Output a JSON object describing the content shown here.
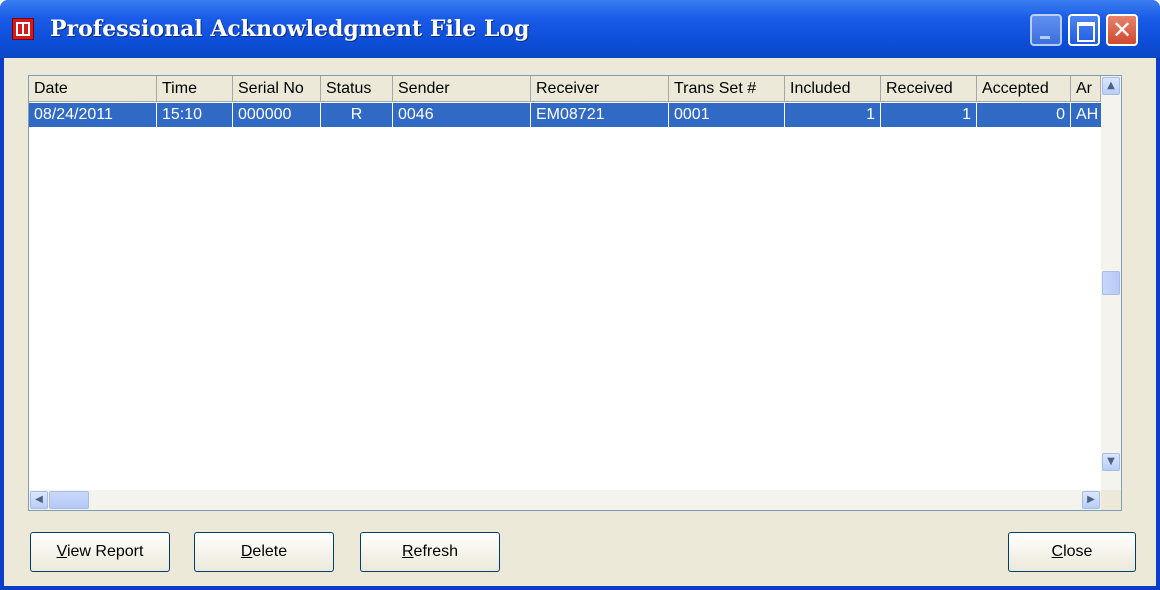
{
  "window": {
    "title": "Professional Acknowledgment File Log"
  },
  "columns": [
    "Date",
    "Time",
    "Serial No",
    "Status",
    "Sender",
    "Receiver",
    "Trans Set #",
    "Included",
    "Received",
    "Accepted",
    "Ar"
  ],
  "rows": [
    {
      "date": "08/24/2011",
      "time": "15:10",
      "serial": "000000",
      "status": "R",
      "sender": "0046",
      "receiver": "EM08721",
      "trans_set": "0001",
      "included": "1",
      "received": "1",
      "accepted": "0",
      "ar": "AH"
    }
  ],
  "selected_row": 0,
  "buttons": {
    "view_report": {
      "mnemonic": "V",
      "rest": "iew Report"
    },
    "delete": {
      "mnemonic": "D",
      "rest": "elete"
    },
    "refresh": {
      "mnemonic": "R",
      "rest": "efresh"
    },
    "close": {
      "mnemonic": "C",
      "rest": "lose"
    }
  },
  "icons": {
    "app": "log-app-icon",
    "minimize": "minimize-icon",
    "maximize": "maximize-icon",
    "close": "close-icon"
  }
}
